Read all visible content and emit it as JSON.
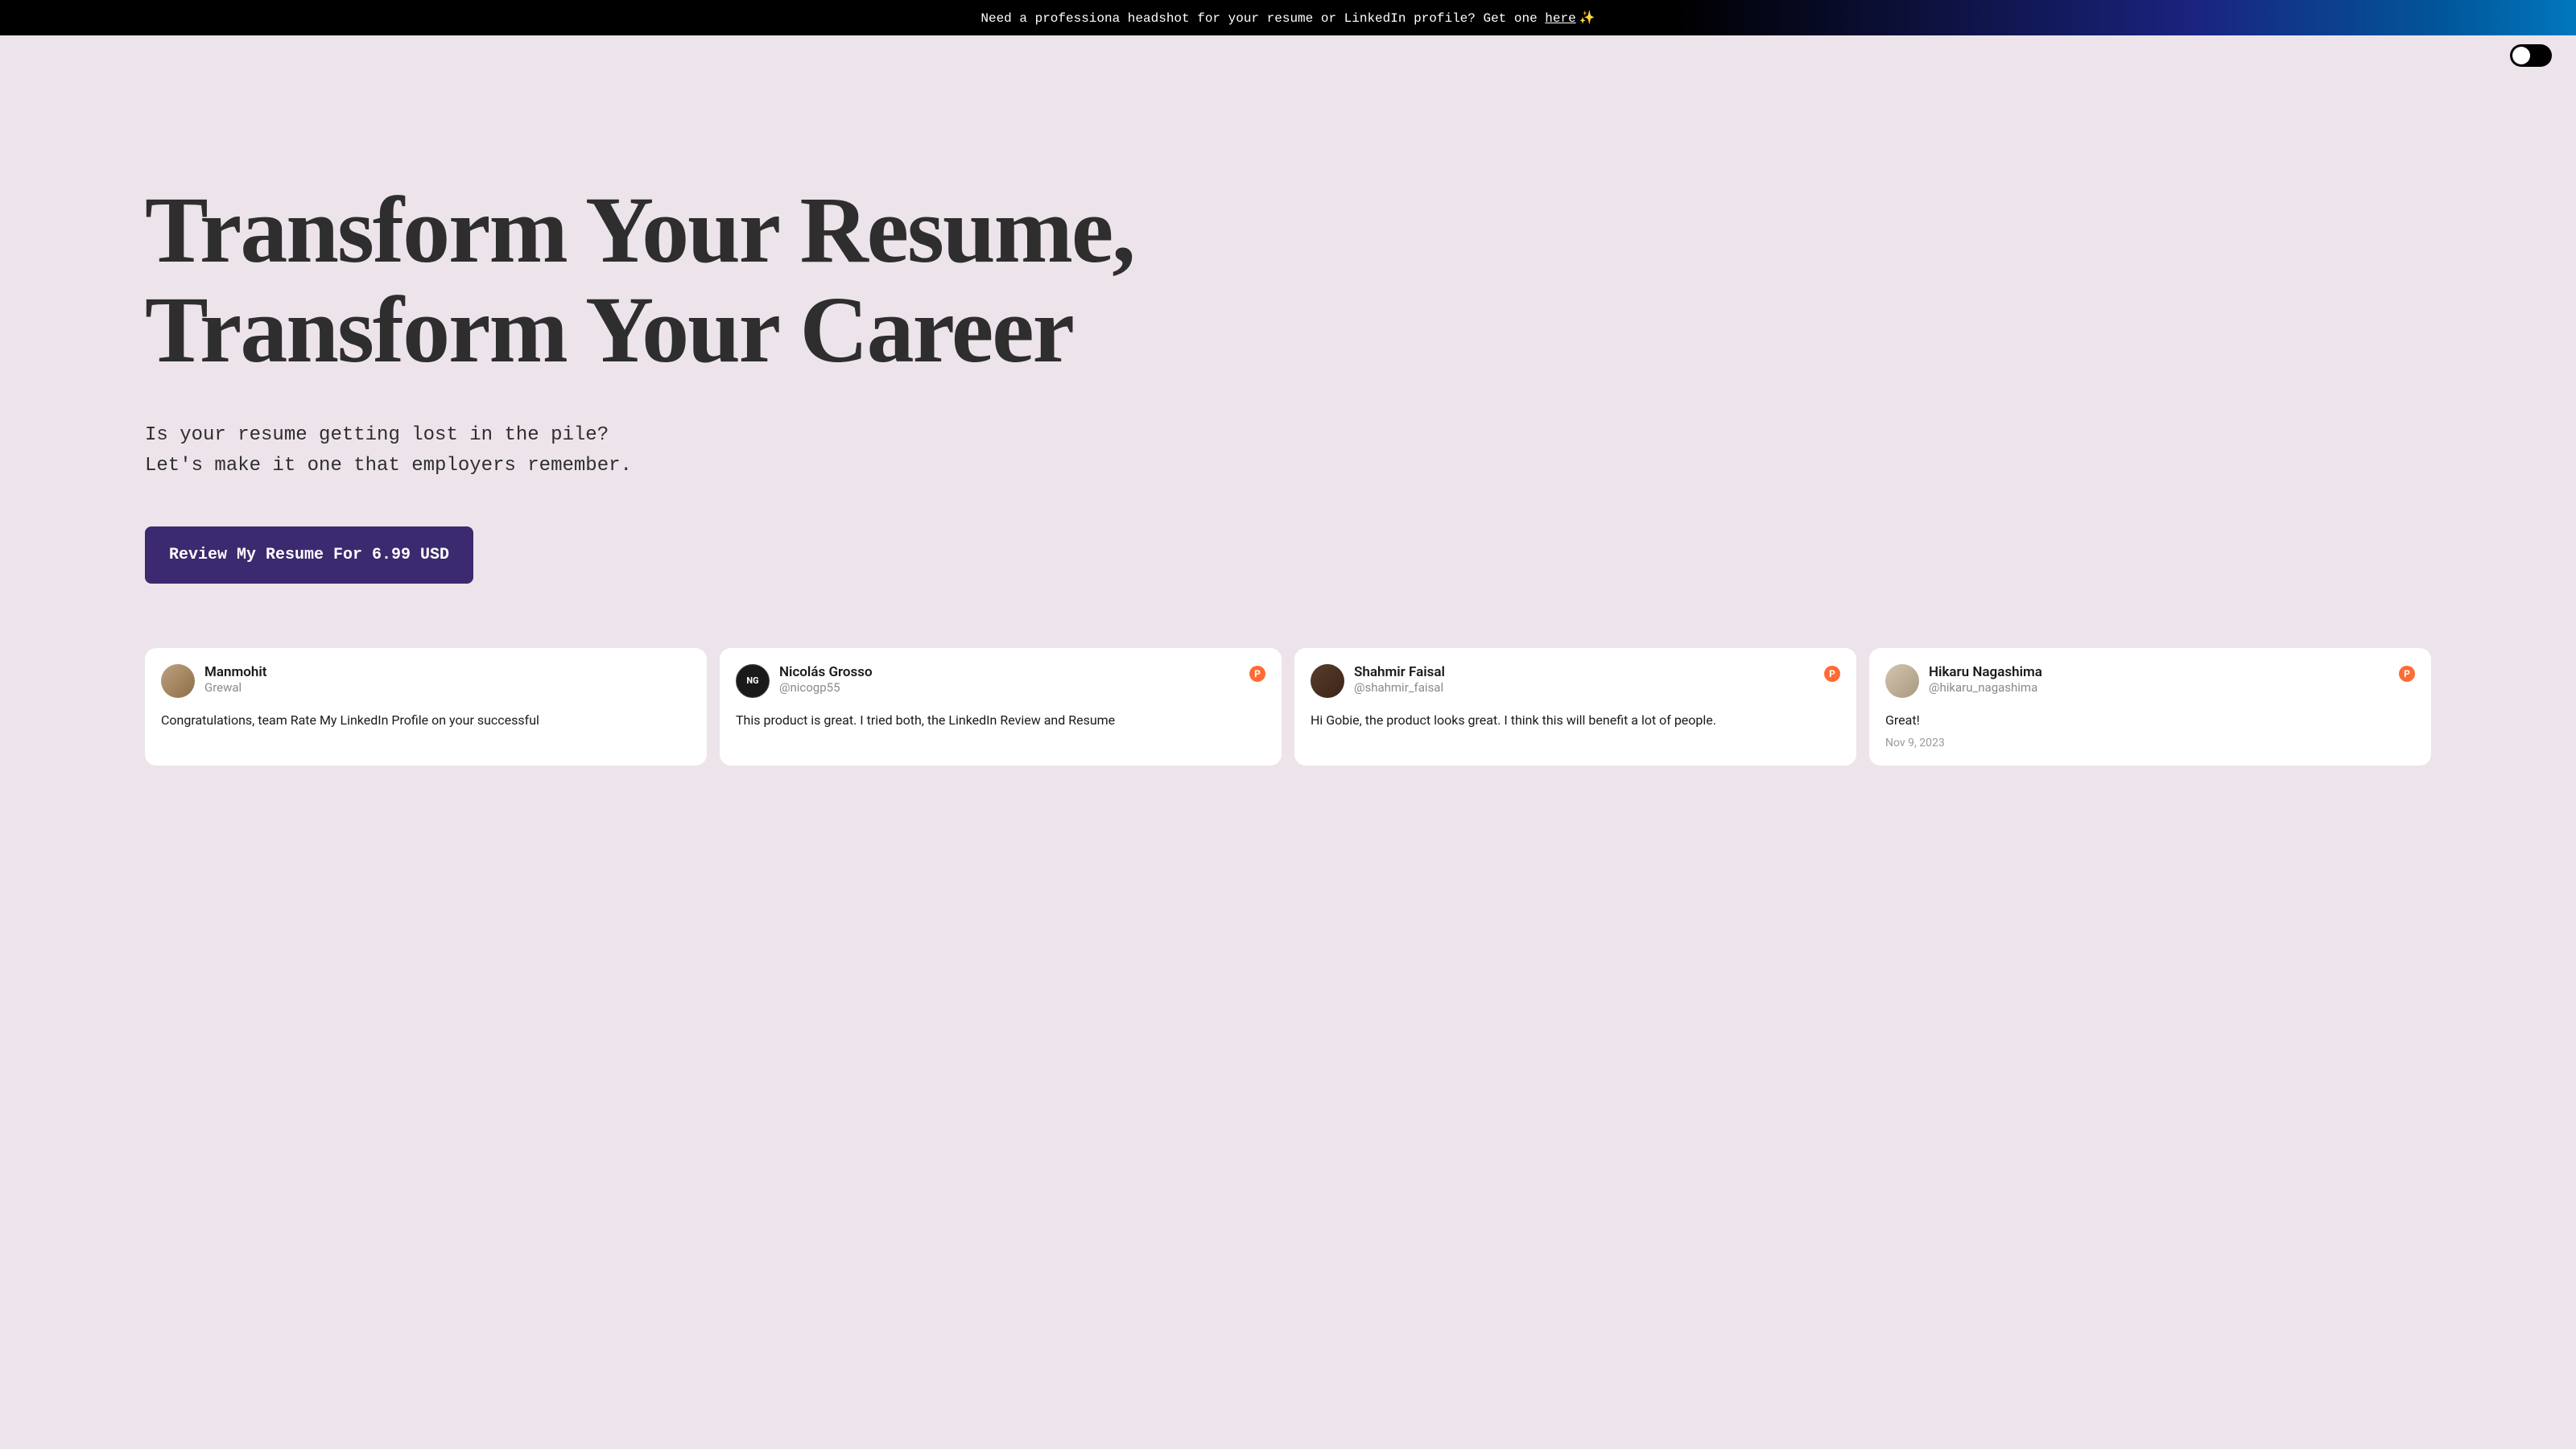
{
  "banner": {
    "text": "Need a professiona headshot for your resume or LinkedIn profile? Get one ",
    "link_text": "here",
    "sparkle": "✨"
  },
  "hero": {
    "title_line1": "Transform Your Resume,",
    "title_line2": "Transform Your Career",
    "subtitle_line1": "Is your resume getting lost in the pile?",
    "subtitle_line2": "Let's make it one that employers remember.",
    "cta_label": "Review My Resume For 6.99 USD"
  },
  "testimonials": [
    {
      "name": "Manmohit",
      "handle": "Grewal",
      "text": "Congratulations, team Rate My LinkedIn Profile on your successful",
      "avatar_label": "",
      "avatar_class": "",
      "show_badge": false,
      "date": ""
    },
    {
      "name": "Nicolás Grosso",
      "handle": "@nicogp55",
      "text": "This product is great. I tried both, the LinkedIn Review and Resume",
      "avatar_label": "NG",
      "avatar_class": "dark",
      "show_badge": true,
      "date": ""
    },
    {
      "name": "Shahmir Faisal",
      "handle": "@shahmir_faisal",
      "text": "Hi Gobie, the product looks great. I think this will benefit a lot of people.",
      "avatar_label": "",
      "avatar_class": "photo2",
      "show_badge": true,
      "date": ""
    },
    {
      "name": "Hikaru Nagashima",
      "handle": "@hikaru_nagashima",
      "text": "Great!",
      "avatar_label": "",
      "avatar_class": "photo3",
      "show_badge": true,
      "date": "Nov 9, 2023"
    }
  ],
  "badge_letter": "P"
}
